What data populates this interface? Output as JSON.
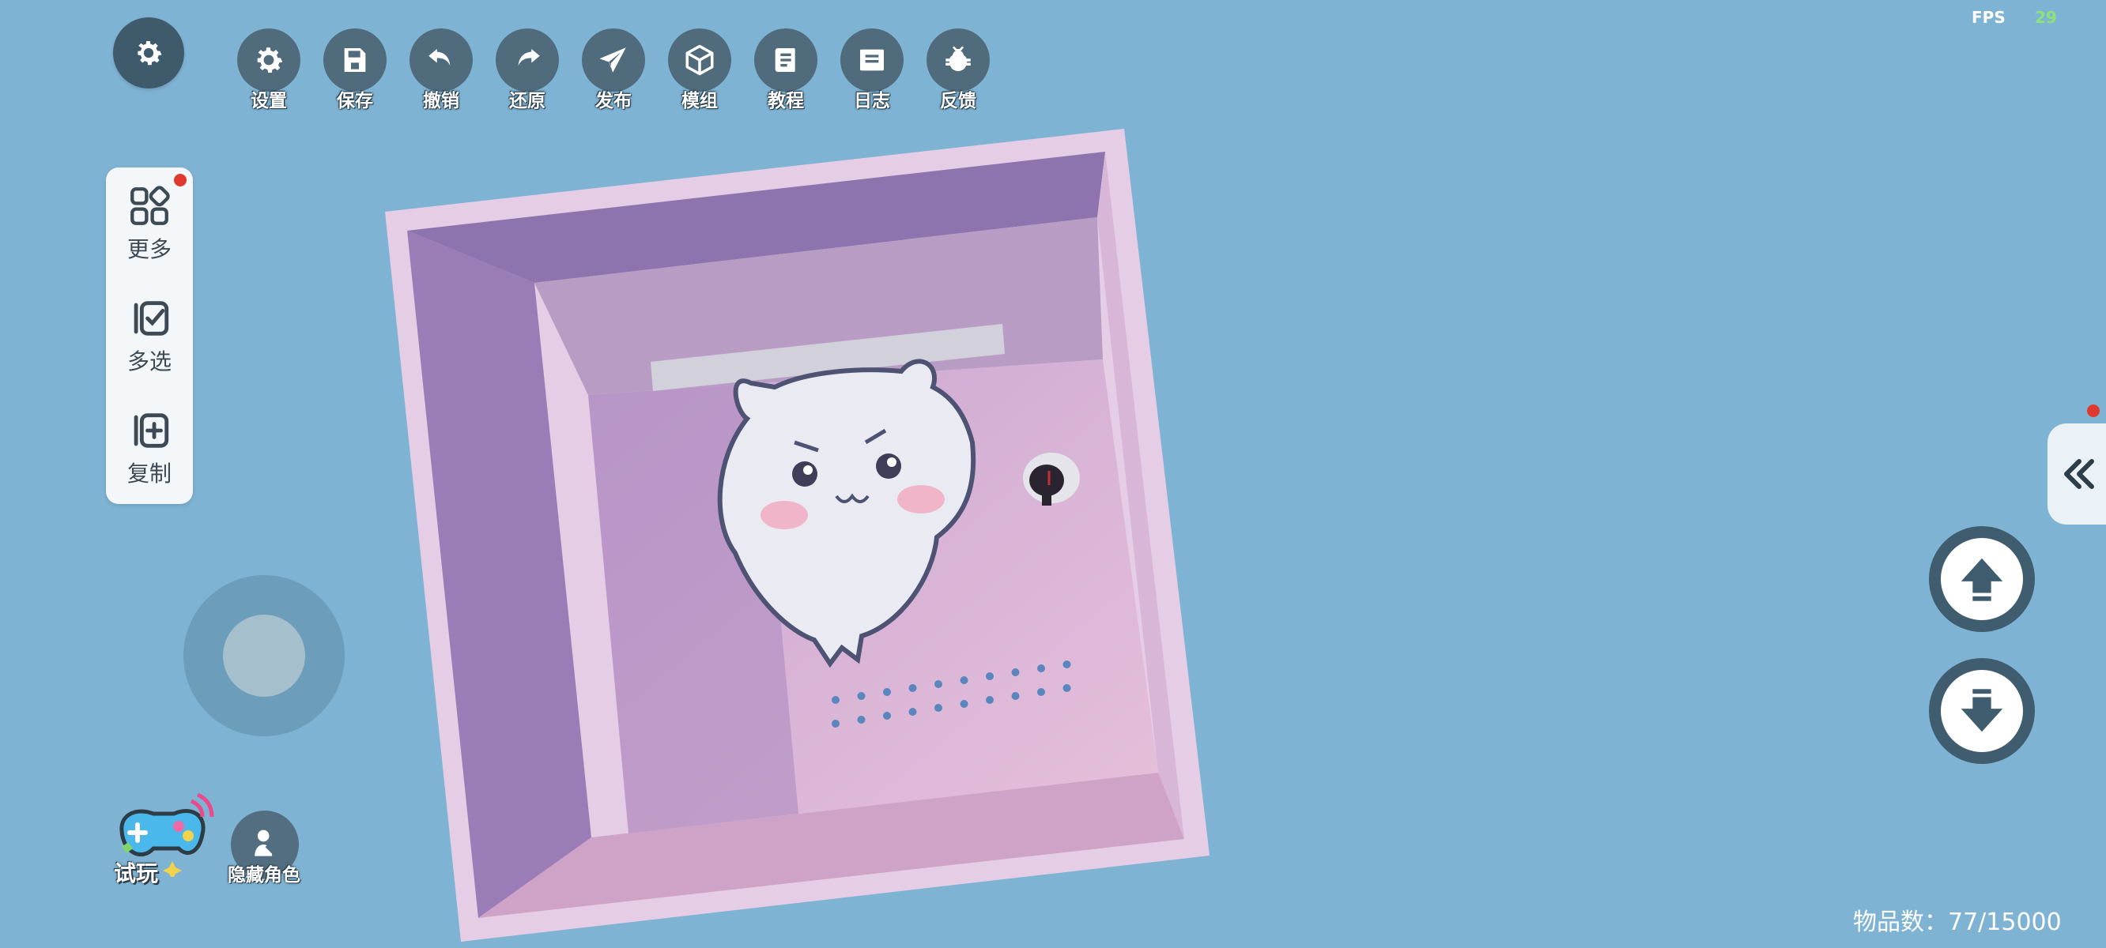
{
  "toolbar": {
    "items": [
      {
        "label": "设置",
        "icon": "gear-icon"
      },
      {
        "label": "保存",
        "icon": "save-icon"
      },
      {
        "label": "撤销",
        "icon": "undo-icon"
      },
      {
        "label": "还原",
        "icon": "redo-icon"
      },
      {
        "label": "发布",
        "icon": "send-icon"
      },
      {
        "label": "模组",
        "icon": "cube-icon"
      },
      {
        "label": "教程",
        "icon": "book-icon"
      },
      {
        "label": "日志",
        "icon": "log-icon"
      },
      {
        "label": "反馈",
        "icon": "bug-icon"
      }
    ]
  },
  "fps": {
    "label": "FPS",
    "value": "29"
  },
  "side_panel": {
    "more_label": "更多",
    "multiselect_label": "多选",
    "copy_label": "复制"
  },
  "bottom_left": {
    "tryplay_label": "试玩",
    "hide_role_label": "隐藏角色"
  },
  "status": {
    "item_count": "物品数：77/15000"
  },
  "colors": {
    "background": "#7fb3d4",
    "accent_dark": "#3f5d6f",
    "notification": "#e03a2f",
    "fps_value": "#8fe27a"
  }
}
